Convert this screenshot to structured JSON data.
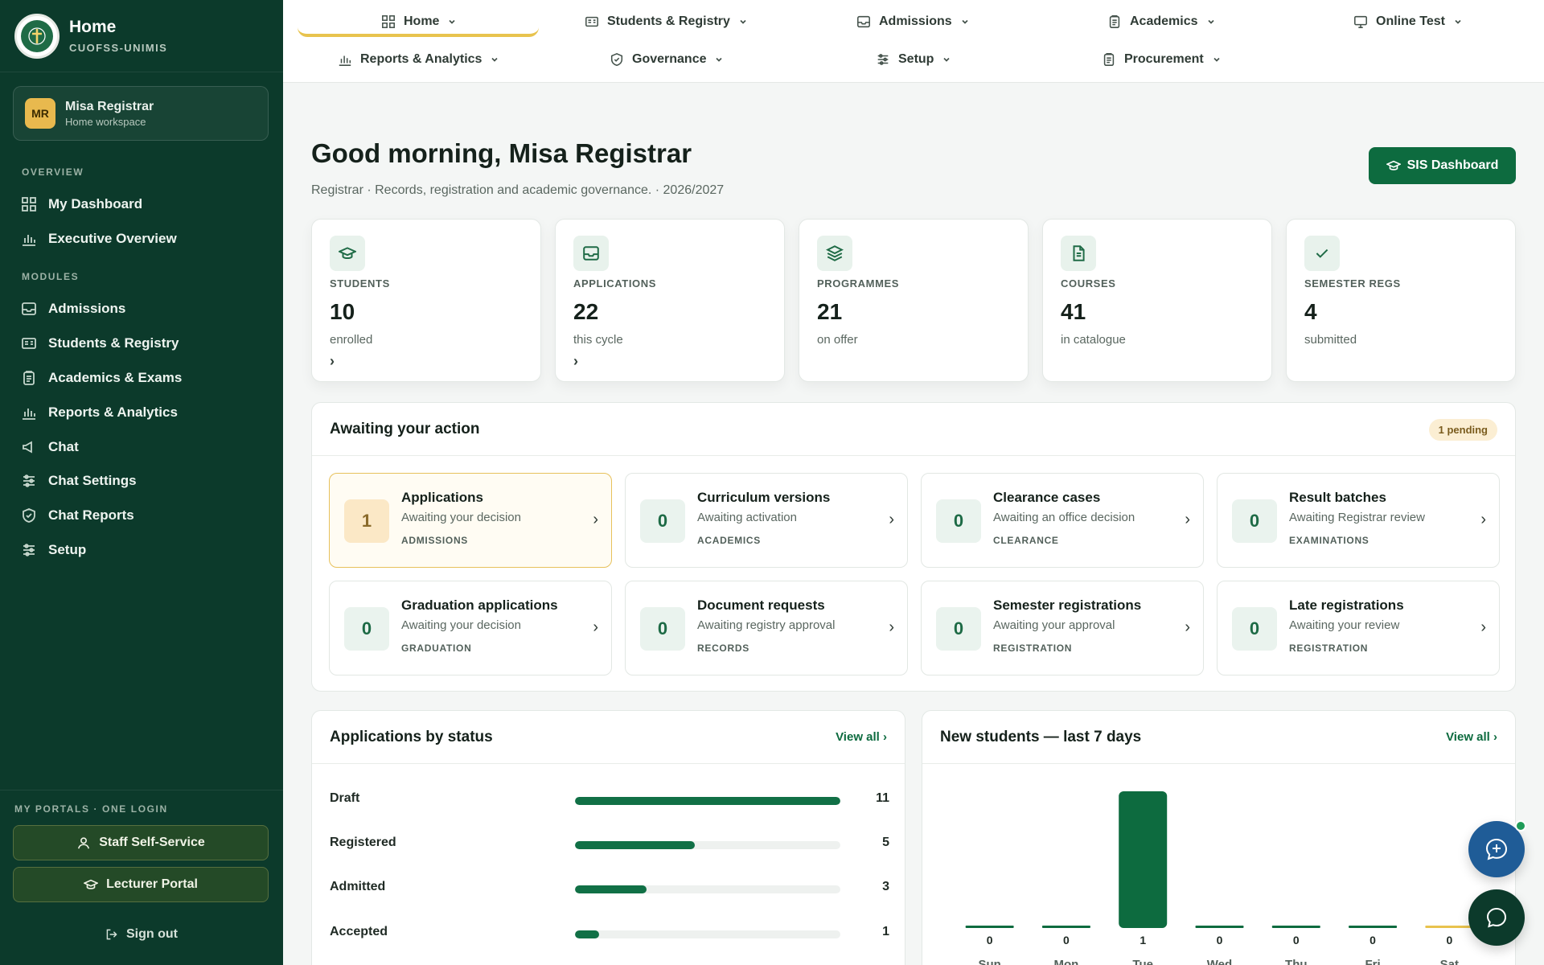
{
  "brand": {
    "title": "Home",
    "subtitle": "CUOFSS-UNIMIS"
  },
  "user": {
    "initials": "MR",
    "name": "Misa Registrar",
    "workspace": "Home workspace"
  },
  "sidebar": {
    "overview_label": "OVERVIEW",
    "overview_items": [
      {
        "label": "My Dashboard",
        "icon": "grid-icon"
      },
      {
        "label": "Executive Overview",
        "icon": "bar-chart-icon"
      }
    ],
    "modules_label": "MODULES",
    "module_items": [
      {
        "label": "Admissions",
        "icon": "inbox-icon"
      },
      {
        "label": "Students & Registry",
        "icon": "id-card-icon"
      },
      {
        "label": "Academics & Exams",
        "icon": "clipboard-icon"
      },
      {
        "label": "Reports & Analytics",
        "icon": "bar-chart-icon"
      },
      {
        "label": "Chat",
        "icon": "megaphone-icon"
      },
      {
        "label": "Chat Settings",
        "icon": "sliders-icon"
      },
      {
        "label": "Chat Reports",
        "icon": "shield-icon"
      },
      {
        "label": "Setup",
        "icon": "sliders-icon"
      }
    ],
    "portals_label": "MY PORTALS · ONE LOGIN",
    "portals": [
      {
        "label": "Staff Self-Service",
        "icon": "user-icon"
      },
      {
        "label": "Lecturer Portal",
        "icon": "graduation-cap-icon"
      }
    ],
    "signout": "Sign out"
  },
  "topnav": {
    "items": [
      {
        "label": "Home",
        "icon": "grid-icon",
        "active": true
      },
      {
        "label": "Students & Registry",
        "icon": "id-card-icon"
      },
      {
        "label": "Admissions",
        "icon": "inbox-icon"
      },
      {
        "label": "Academics",
        "icon": "clipboard-icon"
      },
      {
        "label": "Online Test",
        "icon": "monitor-icon"
      },
      {
        "label": "Reports & Analytics",
        "icon": "bar-chart-icon"
      },
      {
        "label": "Governance",
        "icon": "shield-icon"
      },
      {
        "label": "Setup",
        "icon": "sliders-icon"
      },
      {
        "label": "Procurement",
        "icon": "clipboard-icon"
      }
    ]
  },
  "header": {
    "greeting": "Good morning, Misa Registrar",
    "subline": "Registrar · Records, registration and academic governance. · 2026/2027",
    "sis_button": "SIS Dashboard"
  },
  "stats": [
    {
      "label": "STUDENTS",
      "value": "10",
      "sub": "enrolled",
      "icon": "graduation-cap-icon",
      "arrow": "›"
    },
    {
      "label": "APPLICATIONS",
      "value": "22",
      "sub": "this cycle",
      "icon": "inbox-icon",
      "arrow": "›"
    },
    {
      "label": "PROGRAMMES",
      "value": "21",
      "sub": "on offer",
      "icon": "layers-icon",
      "arrow": ""
    },
    {
      "label": "COURSES",
      "value": "41",
      "sub": "in catalogue",
      "icon": "file-icon",
      "arrow": ""
    },
    {
      "label": "SEMESTER REGS",
      "value": "4",
      "sub": "submitted",
      "icon": "check-icon",
      "arrow": ""
    }
  ],
  "awaiting": {
    "title": "Awaiting your action",
    "badge": "1 pending",
    "items": [
      {
        "count": "1",
        "title": "Applications",
        "desc": "Awaiting your decision",
        "tag": "ADMISSIONS",
        "highlight": true
      },
      {
        "count": "0",
        "title": "Curriculum versions",
        "desc": "Awaiting activation",
        "tag": "ACADEMICS"
      },
      {
        "count": "0",
        "title": "Clearance cases",
        "desc": "Awaiting an office decision",
        "tag": "CLEARANCE"
      },
      {
        "count": "0",
        "title": "Result batches",
        "desc": "Awaiting Registrar review",
        "tag": "EXAMINATIONS"
      },
      {
        "count": "0",
        "title": "Graduation applications",
        "desc": "Awaiting your decision",
        "tag": "GRADUATION"
      },
      {
        "count": "0",
        "title": "Document requests",
        "desc": "Awaiting registry approval",
        "tag": "RECORDS"
      },
      {
        "count": "0",
        "title": "Semester registrations",
        "desc": "Awaiting your approval",
        "tag": "REGISTRATION"
      },
      {
        "count": "0",
        "title": "Late registrations",
        "desc": "Awaiting your review",
        "tag": "REGISTRATION"
      }
    ]
  },
  "applications_by_status": {
    "title": "Applications by status",
    "view_all": "View all ›",
    "rows": [
      {
        "label": "Draft",
        "value": "11",
        "fraction": 1.0
      },
      {
        "label": "Registered",
        "value": "5",
        "fraction": 0.45
      },
      {
        "label": "Admitted",
        "value": "3",
        "fraction": 0.27
      },
      {
        "label": "Accepted",
        "value": "1",
        "fraction": 0.09
      }
    ]
  },
  "new_students": {
    "title": "New students — last 7 days",
    "view_all": "View all ›"
  },
  "chart_data": {
    "type": "bar",
    "title": "New students — last 7 days",
    "categories": [
      "Sun",
      "Mon",
      "Tue",
      "Wed",
      "Thu",
      "Fri",
      "Sat"
    ],
    "values": [
      0,
      0,
      1,
      0,
      0,
      0,
      0
    ],
    "ylim": [
      0,
      1
    ],
    "grid": false,
    "colors": {
      "bar": "#0d6b3f",
      "highlight": "#e8c34e"
    }
  },
  "fab": {
    "assistant_icon": "ai-chat-icon",
    "chat_icon": "chat-bubble-icon"
  }
}
